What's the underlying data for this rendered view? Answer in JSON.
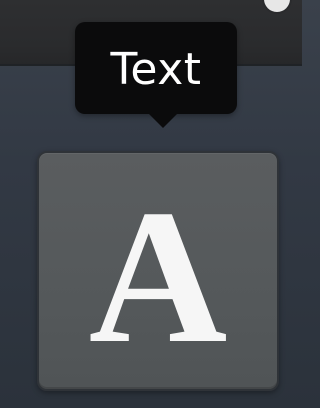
{
  "tooltip": {
    "label": "Text"
  },
  "tool": {
    "icon_name": "text-tool-icon",
    "glyph": "A"
  },
  "colors": {
    "background": "#343b45",
    "topbar": "#2b2c2e",
    "tooltip_bg": "#0b0b0c",
    "button_bg": "#56595b",
    "glyph": "#f6f6f6"
  }
}
